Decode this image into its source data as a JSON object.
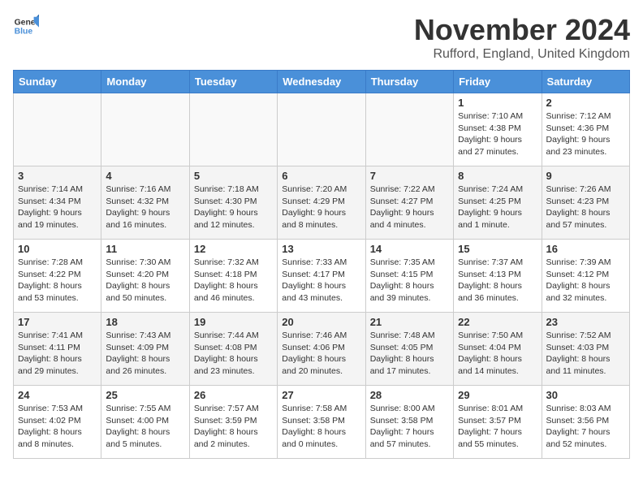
{
  "logo": {
    "text_general": "General",
    "text_blue": "Blue"
  },
  "title": "November 2024",
  "location": "Rufford, England, United Kingdom",
  "headers": [
    "Sunday",
    "Monday",
    "Tuesday",
    "Wednesday",
    "Thursday",
    "Friday",
    "Saturday"
  ],
  "weeks": [
    [
      {
        "day": "",
        "info": ""
      },
      {
        "day": "",
        "info": ""
      },
      {
        "day": "",
        "info": ""
      },
      {
        "day": "",
        "info": ""
      },
      {
        "day": "",
        "info": ""
      },
      {
        "day": "1",
        "info": "Sunrise: 7:10 AM\nSunset: 4:38 PM\nDaylight: 9 hours and 27 minutes."
      },
      {
        "day": "2",
        "info": "Sunrise: 7:12 AM\nSunset: 4:36 PM\nDaylight: 9 hours and 23 minutes."
      }
    ],
    [
      {
        "day": "3",
        "info": "Sunrise: 7:14 AM\nSunset: 4:34 PM\nDaylight: 9 hours and 19 minutes."
      },
      {
        "day": "4",
        "info": "Sunrise: 7:16 AM\nSunset: 4:32 PM\nDaylight: 9 hours and 16 minutes."
      },
      {
        "day": "5",
        "info": "Sunrise: 7:18 AM\nSunset: 4:30 PM\nDaylight: 9 hours and 12 minutes."
      },
      {
        "day": "6",
        "info": "Sunrise: 7:20 AM\nSunset: 4:29 PM\nDaylight: 9 hours and 8 minutes."
      },
      {
        "day": "7",
        "info": "Sunrise: 7:22 AM\nSunset: 4:27 PM\nDaylight: 9 hours and 4 minutes."
      },
      {
        "day": "8",
        "info": "Sunrise: 7:24 AM\nSunset: 4:25 PM\nDaylight: 9 hours and 1 minute."
      },
      {
        "day": "9",
        "info": "Sunrise: 7:26 AM\nSunset: 4:23 PM\nDaylight: 8 hours and 57 minutes."
      }
    ],
    [
      {
        "day": "10",
        "info": "Sunrise: 7:28 AM\nSunset: 4:22 PM\nDaylight: 8 hours and 53 minutes."
      },
      {
        "day": "11",
        "info": "Sunrise: 7:30 AM\nSunset: 4:20 PM\nDaylight: 8 hours and 50 minutes."
      },
      {
        "day": "12",
        "info": "Sunrise: 7:32 AM\nSunset: 4:18 PM\nDaylight: 8 hours and 46 minutes."
      },
      {
        "day": "13",
        "info": "Sunrise: 7:33 AM\nSunset: 4:17 PM\nDaylight: 8 hours and 43 minutes."
      },
      {
        "day": "14",
        "info": "Sunrise: 7:35 AM\nSunset: 4:15 PM\nDaylight: 8 hours and 39 minutes."
      },
      {
        "day": "15",
        "info": "Sunrise: 7:37 AM\nSunset: 4:13 PM\nDaylight: 8 hours and 36 minutes."
      },
      {
        "day": "16",
        "info": "Sunrise: 7:39 AM\nSunset: 4:12 PM\nDaylight: 8 hours and 32 minutes."
      }
    ],
    [
      {
        "day": "17",
        "info": "Sunrise: 7:41 AM\nSunset: 4:11 PM\nDaylight: 8 hours and 29 minutes."
      },
      {
        "day": "18",
        "info": "Sunrise: 7:43 AM\nSunset: 4:09 PM\nDaylight: 8 hours and 26 minutes."
      },
      {
        "day": "19",
        "info": "Sunrise: 7:44 AM\nSunset: 4:08 PM\nDaylight: 8 hours and 23 minutes."
      },
      {
        "day": "20",
        "info": "Sunrise: 7:46 AM\nSunset: 4:06 PM\nDaylight: 8 hours and 20 minutes."
      },
      {
        "day": "21",
        "info": "Sunrise: 7:48 AM\nSunset: 4:05 PM\nDaylight: 8 hours and 17 minutes."
      },
      {
        "day": "22",
        "info": "Sunrise: 7:50 AM\nSunset: 4:04 PM\nDaylight: 8 hours and 14 minutes."
      },
      {
        "day": "23",
        "info": "Sunrise: 7:52 AM\nSunset: 4:03 PM\nDaylight: 8 hours and 11 minutes."
      }
    ],
    [
      {
        "day": "24",
        "info": "Sunrise: 7:53 AM\nSunset: 4:02 PM\nDaylight: 8 hours and 8 minutes."
      },
      {
        "day": "25",
        "info": "Sunrise: 7:55 AM\nSunset: 4:00 PM\nDaylight: 8 hours and 5 minutes."
      },
      {
        "day": "26",
        "info": "Sunrise: 7:57 AM\nSunset: 3:59 PM\nDaylight: 8 hours and 2 minutes."
      },
      {
        "day": "27",
        "info": "Sunrise: 7:58 AM\nSunset: 3:58 PM\nDaylight: 8 hours and 0 minutes."
      },
      {
        "day": "28",
        "info": "Sunrise: 8:00 AM\nSunset: 3:58 PM\nDaylight: 7 hours and 57 minutes."
      },
      {
        "day": "29",
        "info": "Sunrise: 8:01 AM\nSunset: 3:57 PM\nDaylight: 7 hours and 55 minutes."
      },
      {
        "day": "30",
        "info": "Sunrise: 8:03 AM\nSunset: 3:56 PM\nDaylight: 7 hours and 52 minutes."
      }
    ]
  ]
}
